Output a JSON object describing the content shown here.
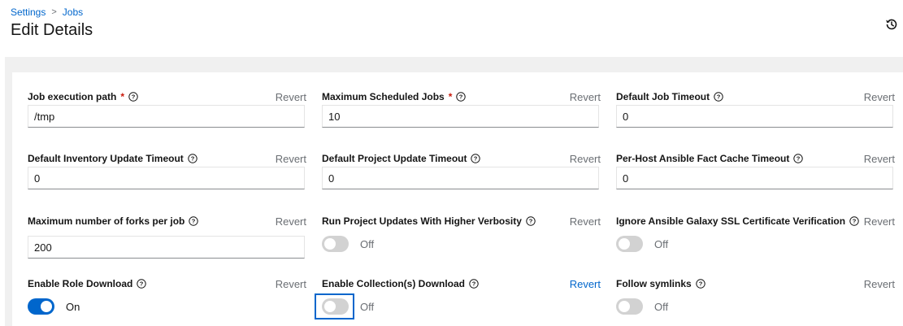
{
  "breadcrumb": {
    "parent": "Settings",
    "separator": ">",
    "current": "Jobs"
  },
  "page_title": "Edit Details",
  "icons": {
    "history": "history-icon",
    "help": "question-circle-icon"
  },
  "colors": {
    "link": "#0066cc",
    "required": "#c9190b",
    "switch_on": "#0066cc",
    "switch_off": "#d2d2d2"
  },
  "revert_label": "Revert",
  "fields": [
    {
      "label": "Job execution path",
      "required": true,
      "type": "input",
      "value": "/tmp"
    },
    {
      "label": "Maximum Scheduled Jobs",
      "required": true,
      "type": "input",
      "value": "10"
    },
    {
      "label": "Default Job Timeout",
      "required": false,
      "type": "input",
      "value": "0"
    },
    {
      "label": "Default Inventory Update Timeout",
      "required": false,
      "type": "input",
      "value": "0"
    },
    {
      "label": "Default Project Update Timeout",
      "required": false,
      "type": "input",
      "value": "0"
    },
    {
      "label": "Per-Host Ansible Fact Cache Timeout",
      "required": false,
      "type": "input",
      "value": "0"
    },
    {
      "label": "Maximum number of forks per job",
      "required": false,
      "type": "input",
      "value": "200"
    },
    {
      "label": "Run Project Updates With Higher Verbosity",
      "required": false,
      "type": "switch",
      "state": "Off"
    },
    {
      "label": "Ignore Ansible Galaxy SSL Certificate Verification",
      "required": false,
      "type": "switch",
      "state": "Off"
    },
    {
      "label": "Enable Role Download",
      "required": false,
      "type": "switch",
      "state": "On"
    },
    {
      "label": "Enable Collection(s) Download",
      "required": false,
      "type": "switch",
      "state": "Off",
      "revert_active": true,
      "focused": true
    },
    {
      "label": "Follow symlinks",
      "required": false,
      "type": "switch",
      "state": "Off"
    }
  ]
}
